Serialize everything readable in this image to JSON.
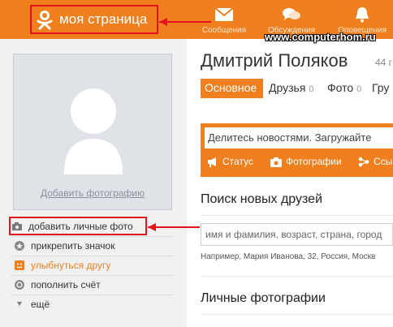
{
  "header": {
    "logo_text": "моя страница",
    "nav": [
      {
        "label": "Сообщения",
        "icon": "envelope-icon"
      },
      {
        "label": "Обсуждения",
        "icon": "chat-bubbles-icon"
      },
      {
        "label": "Оповещения",
        "icon": "bell-icon"
      }
    ],
    "accent": "#f07f1e"
  },
  "watermark": "www.computerhom.ru",
  "left": {
    "add_photo_link": "Добавить фотографию",
    "menu": [
      {
        "label": "добавить личные фото",
        "icon": "camera-icon"
      },
      {
        "label": "прикрепить значок",
        "icon": "star-badge-icon"
      },
      {
        "label": "улыбнуться другу",
        "icon": "smile-icon"
      },
      {
        "label": "пополнить счёт",
        "icon": "coins-icon"
      },
      {
        "label": "ещё",
        "icon": "triangle-down-icon"
      }
    ]
  },
  "profile": {
    "name": "Дмитрий Поляков",
    "age": "44 г",
    "tabs": [
      {
        "label": "Основное",
        "count": ""
      },
      {
        "label": "Друзья",
        "count": "0"
      },
      {
        "label": "Фото",
        "count": "0"
      },
      {
        "label": "Гру",
        "count": ""
      }
    ]
  },
  "post": {
    "placeholder": "Делитесь новостями. Загружайте",
    "actions": [
      {
        "label": "Статус",
        "icon": "megaphone-icon"
      },
      {
        "label": "Фотографии",
        "icon": "camera-icon"
      },
      {
        "label": "Ссы",
        "icon": "link-icon"
      }
    ]
  },
  "friends_search": {
    "title": "Поиск новых друзей",
    "placeholder": "имя и фамилия, возраст, страна, город",
    "example": "Например, Мария Иванова, 32, Россия, Москв"
  },
  "photos": {
    "title": "Личные фотографии"
  }
}
